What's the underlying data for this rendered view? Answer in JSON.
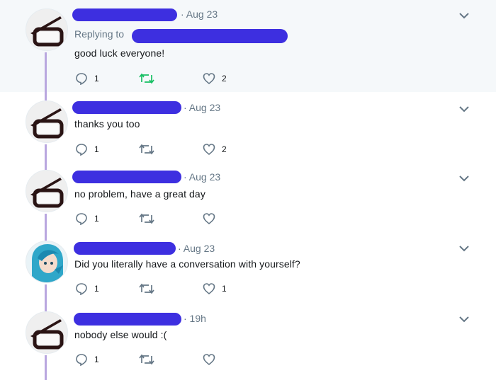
{
  "colors": {
    "redaction": "#3d2fe0",
    "thread_line": "#b9a7df",
    "icon_gray": "#657786",
    "retweet_active": "#17bf63",
    "highlight_bg": "#f5f8fa"
  },
  "icons": {
    "reply": "reply-icon",
    "retweet": "retweet-icon",
    "like": "heart-icon",
    "more": "chevron-down-icon"
  },
  "tweets": [
    {
      "avatar": "glasses-avatar",
      "date": "· Aug 23",
      "replying_label": "Replying to",
      "text": "good luck everyone!",
      "reply_count": "1",
      "retweet_active": true,
      "like_count": "2"
    },
    {
      "avatar": "glasses-avatar",
      "date": "· Aug 23",
      "text": "thanks you too",
      "reply_count": "1",
      "retweet_active": false,
      "like_count": "2"
    },
    {
      "avatar": "glasses-avatar",
      "date": "· Aug 23",
      "text": "no problem, have a great day",
      "reply_count": "1",
      "retweet_active": false,
      "like_count": ""
    },
    {
      "avatar": "anime-avatar",
      "date": "· Aug 23",
      "text": "Did you literally have a conversation with yourself?",
      "reply_count": "1",
      "retweet_active": false,
      "like_count": "1"
    },
    {
      "avatar": "glasses-avatar",
      "date": "· 19h",
      "text": "nobody else would :(",
      "reply_count": "1",
      "retweet_active": false,
      "like_count": ""
    }
  ]
}
